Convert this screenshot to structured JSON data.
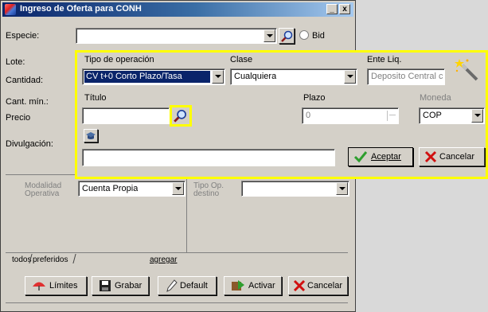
{
  "window": {
    "title": "Ingreso de Oferta para CONH",
    "minimize_label": "_",
    "close_label": "x"
  },
  "form": {
    "especie_label": "Especie:",
    "lote_label": "Lote:",
    "cantidad_label": "Cantidad:",
    "cant_min_label": "Cant. mín.:",
    "precio_label": "Precio",
    "divulgacion_label": "Divulgación:",
    "bid_label": "Bid",
    "modalidad_label": "Modalidad Operativa",
    "modalidad_value": "Cuenta Propia",
    "tipo_op_destino_label": "Tipo Op. destino",
    "tipo_op_destino_value": ""
  },
  "popup": {
    "tipo_operacion_label": "Tipo de operación",
    "tipo_operacion_value": "CV t+0 Corto Plazo/Tasa",
    "clase_label": "Clase",
    "clase_value": "Cualquiera",
    "ente_liq_label": "Ente Liq.",
    "ente_liq_value": "Deposito Central c",
    "titulo_label": "Título",
    "titulo_value": "",
    "plazo_label": "Plazo",
    "plazo_value": "0",
    "moneda_label": "Moneda",
    "moneda_value": "COP",
    "description_value": "",
    "aceptar_label": "Aceptar",
    "cancelar_label": "Cancelar"
  },
  "tabs": {
    "todos": "todos",
    "preferidos": "preferidos",
    "agregar": "agregar"
  },
  "buttons": {
    "limites": "Límites",
    "grabar": "Grabar",
    "default": "Default",
    "activar": "Activar",
    "cancelar": "Cancelar"
  },
  "colors": {
    "highlight": "#ffff00",
    "selected_bg": "#0a246a",
    "face": "#d4d0c8"
  }
}
